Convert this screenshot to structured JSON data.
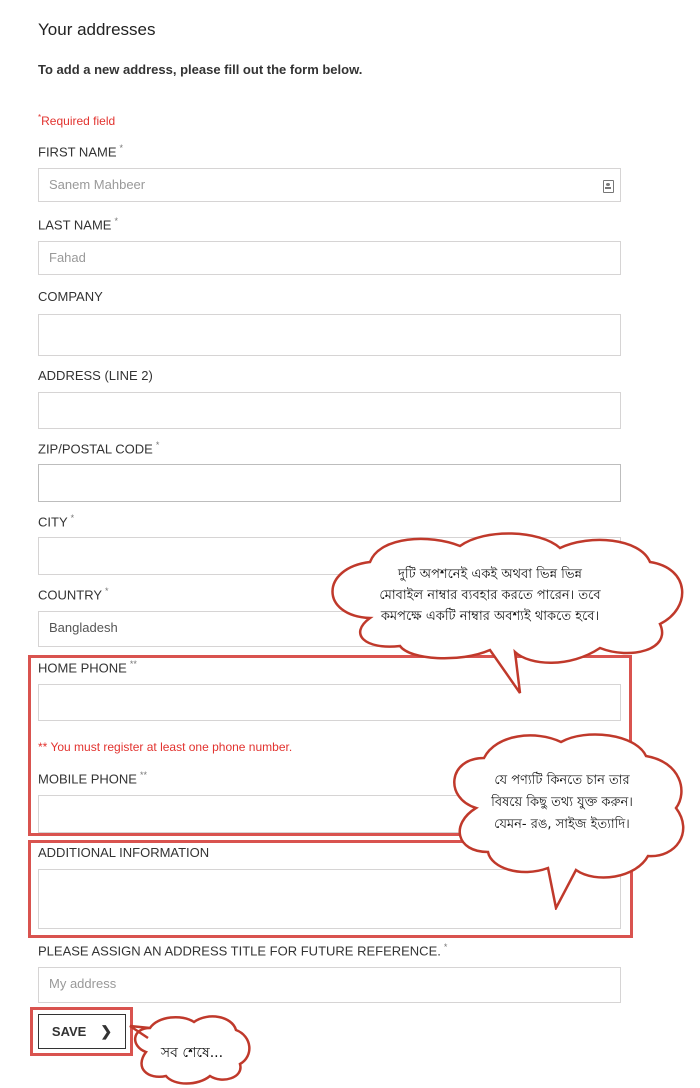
{
  "page": {
    "title": "Your addresses",
    "subtitle": "To add a new address, please fill out the form below.",
    "required_note": "Required field",
    "required_mark": "*"
  },
  "fields": {
    "first_name": {
      "label": "FIRST NAME",
      "mark": "*",
      "value": "Sanem Mahbeer"
    },
    "last_name": {
      "label": "LAST NAME",
      "mark": "*",
      "value": "Fahad"
    },
    "company": {
      "label": "COMPANY",
      "value": ""
    },
    "address2": {
      "label": "ADDRESS (LINE 2)",
      "value": ""
    },
    "zip": {
      "label": "ZIP/POSTAL CODE",
      "mark": "*",
      "value": ""
    },
    "city": {
      "label": "CITY",
      "mark": "*",
      "value": ""
    },
    "country": {
      "label": "COUNTRY",
      "mark": "*",
      "value": "Bangladesh"
    },
    "home_phone": {
      "label": "HOME PHONE",
      "mark": "**",
      "value": ""
    },
    "phone_note": "** You must register at least one phone number.",
    "mobile_phone": {
      "label": "MOBILE PHONE",
      "mark": "**",
      "value": ""
    },
    "additional_info": {
      "label": "ADDITIONAL INFORMATION",
      "value": ""
    },
    "alias": {
      "label": "PLEASE ASSIGN AN ADDRESS TITLE FOR FUTURE REFERENCE.",
      "mark": "*",
      "placeholder": "My address"
    }
  },
  "actions": {
    "save_label": "SAVE",
    "save_icon": "chevron-right-icon"
  },
  "callouts": {
    "phone": [
      "দুটি অপশনেই একই অথবা ভিন্ন ভিন্ন",
      "মোবাইল নাম্বার ব্যবহার করতে পারেন। তবে",
      "কমপক্ষে একটি নাম্বার অবশ্যই থাকতে হবে।"
    ],
    "info": [
      "যে পণ্যটি কিনতে চান তার",
      "বিষয়ে কিছু তথ্য যুক্ত করুন।",
      "যেমন- রঙ, সাইজ ইত্যাদি।"
    ],
    "save": [
      "সব শেষে..."
    ]
  },
  "colors": {
    "highlight": "#d9534f",
    "required": "#e2332f",
    "bubble_stroke": "#c0392b"
  }
}
